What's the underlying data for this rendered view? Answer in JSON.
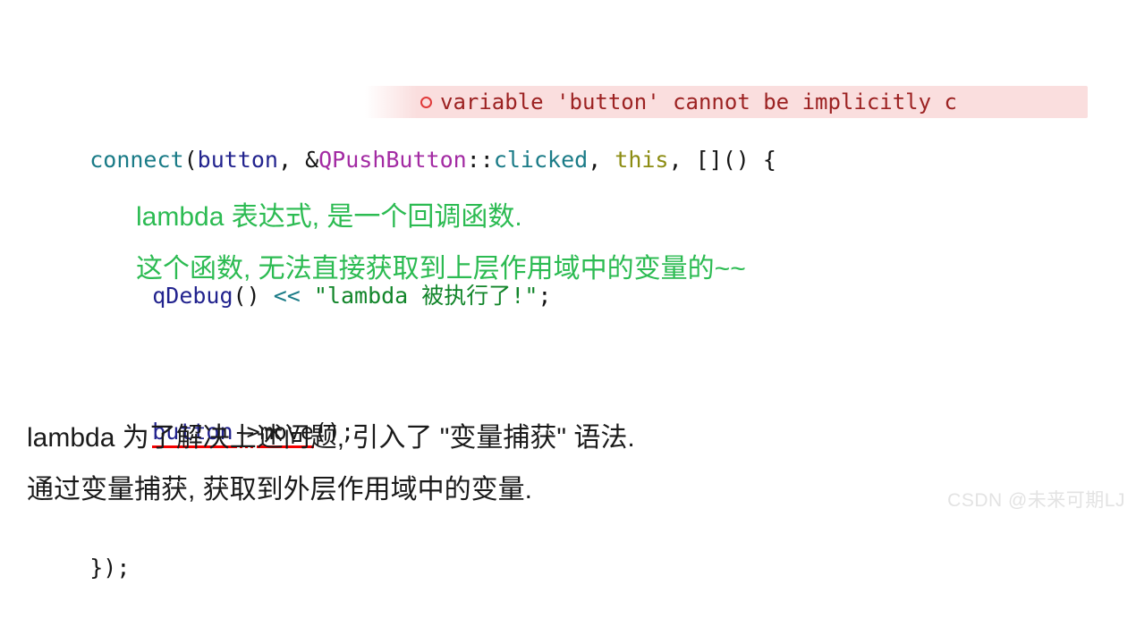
{
  "code": {
    "language": "cpp",
    "lines": [
      {
        "id": "line-1",
        "tokens": [
          {
            "text": "connect",
            "kind": "function"
          },
          {
            "text": "(",
            "kind": "punct"
          },
          {
            "text": "button",
            "kind": "variable"
          },
          {
            "text": ", ",
            "kind": "punct"
          },
          {
            "text": "&",
            "kind": "punct"
          },
          {
            "text": "QPushButton",
            "kind": "type"
          },
          {
            "text": "::",
            "kind": "punct"
          },
          {
            "text": "clicked",
            "kind": "function"
          },
          {
            "text": ", ",
            "kind": "punct"
          },
          {
            "text": "this",
            "kind": "keyword"
          },
          {
            "text": ", []() {",
            "kind": "punct"
          }
        ]
      },
      {
        "id": "line-2",
        "tokens": [
          {
            "text": "qDebug",
            "kind": "variable"
          },
          {
            "text": "() ",
            "kind": "punct"
          },
          {
            "text": "<<",
            "kind": "operator"
          },
          {
            "text": " ",
            "kind": "punct"
          },
          {
            "text": "\"lambda 被执行了!\"",
            "kind": "string"
          },
          {
            "text": ";",
            "kind": "punct"
          }
        ]
      },
      {
        "id": "line-3",
        "tokens": [
          {
            "text": "button",
            "kind": "error-underline"
          },
          {
            "text": "->",
            "kind": "error-dots"
          },
          {
            "text": "move",
            "kind": "error-underline-plain"
          },
          {
            "text": "();",
            "kind": "punct"
          }
        ]
      },
      {
        "id": "line-4",
        "tokens": [
          {
            "text": "});",
            "kind": "punct"
          }
        ]
      }
    ],
    "line1_text": "connect(button, &QPushButton::clicked, this, []() {",
    "line2_text": "qDebug() << \"lambda 被执行了!\";",
    "line3_text": "button->move();",
    "line4_text": "});"
  },
  "diagnostic": {
    "icon": "circle-outline-icon",
    "severity": "error",
    "message": "variable 'button' cannot be implicitly c",
    "truncated": true,
    "background_color": "#fadede",
    "text_color": "#9c2222",
    "icon_color": "#e03a3a"
  },
  "annotation_green": {
    "color": "#2cbb52",
    "lines": [
      "lambda 表达式, 是一个回调函数.",
      "这个函数, 无法直接获取到上层作用域中的变量的~~"
    ]
  },
  "body_text": {
    "color": "#1a1a1a",
    "lines": [
      "lambda 为了解决上述问题, 引入了 \"变量捕获\" 语法.",
      "通过变量捕获, 获取到外层作用域中的变量."
    ]
  },
  "watermark": {
    "text": "CSDN @未来可期LJ",
    "color": "#e3e3e3"
  },
  "colors": {
    "background": "#ffffff",
    "token_function": "#1a7b87",
    "token_variable": "#22238e",
    "token_type": "#a32ba3",
    "token_keyword": "#8c8c12",
    "token_string": "#12852a",
    "token_punct": "#151515",
    "squiggle": "#f50000"
  }
}
